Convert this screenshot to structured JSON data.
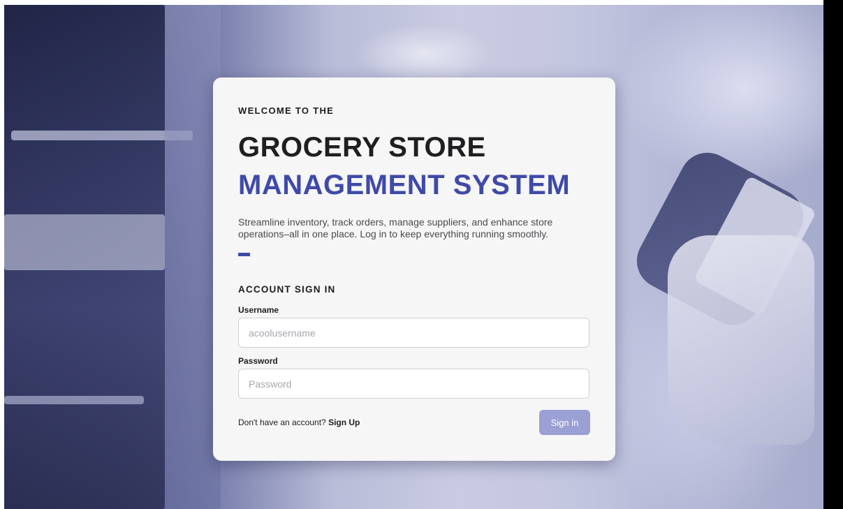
{
  "hero": {
    "eyebrow": "WELCOME TO THE",
    "title_line1": "GROCERY STORE",
    "title_line2": "MANAGEMENT SYSTEM",
    "tagline": "Streamline inventory, track orders, manage suppliers, and enhance store operations–all in one place. Log in to keep everything running smoothly."
  },
  "signin": {
    "section_title": "ACCOUNT SIGN IN",
    "username_label": "Username",
    "username_placeholder": "acoolusername",
    "password_label": "Password",
    "password_placeholder": "Password",
    "no_account_text": "Don't have an account?",
    "signup_label": "Sign Up",
    "submit_label": "Sign in"
  },
  "colors": {
    "accent": "#3f4aa8",
    "button": "#9aa0d3",
    "card": "#f6f6f7",
    "background_tint": "#6f75a6"
  }
}
